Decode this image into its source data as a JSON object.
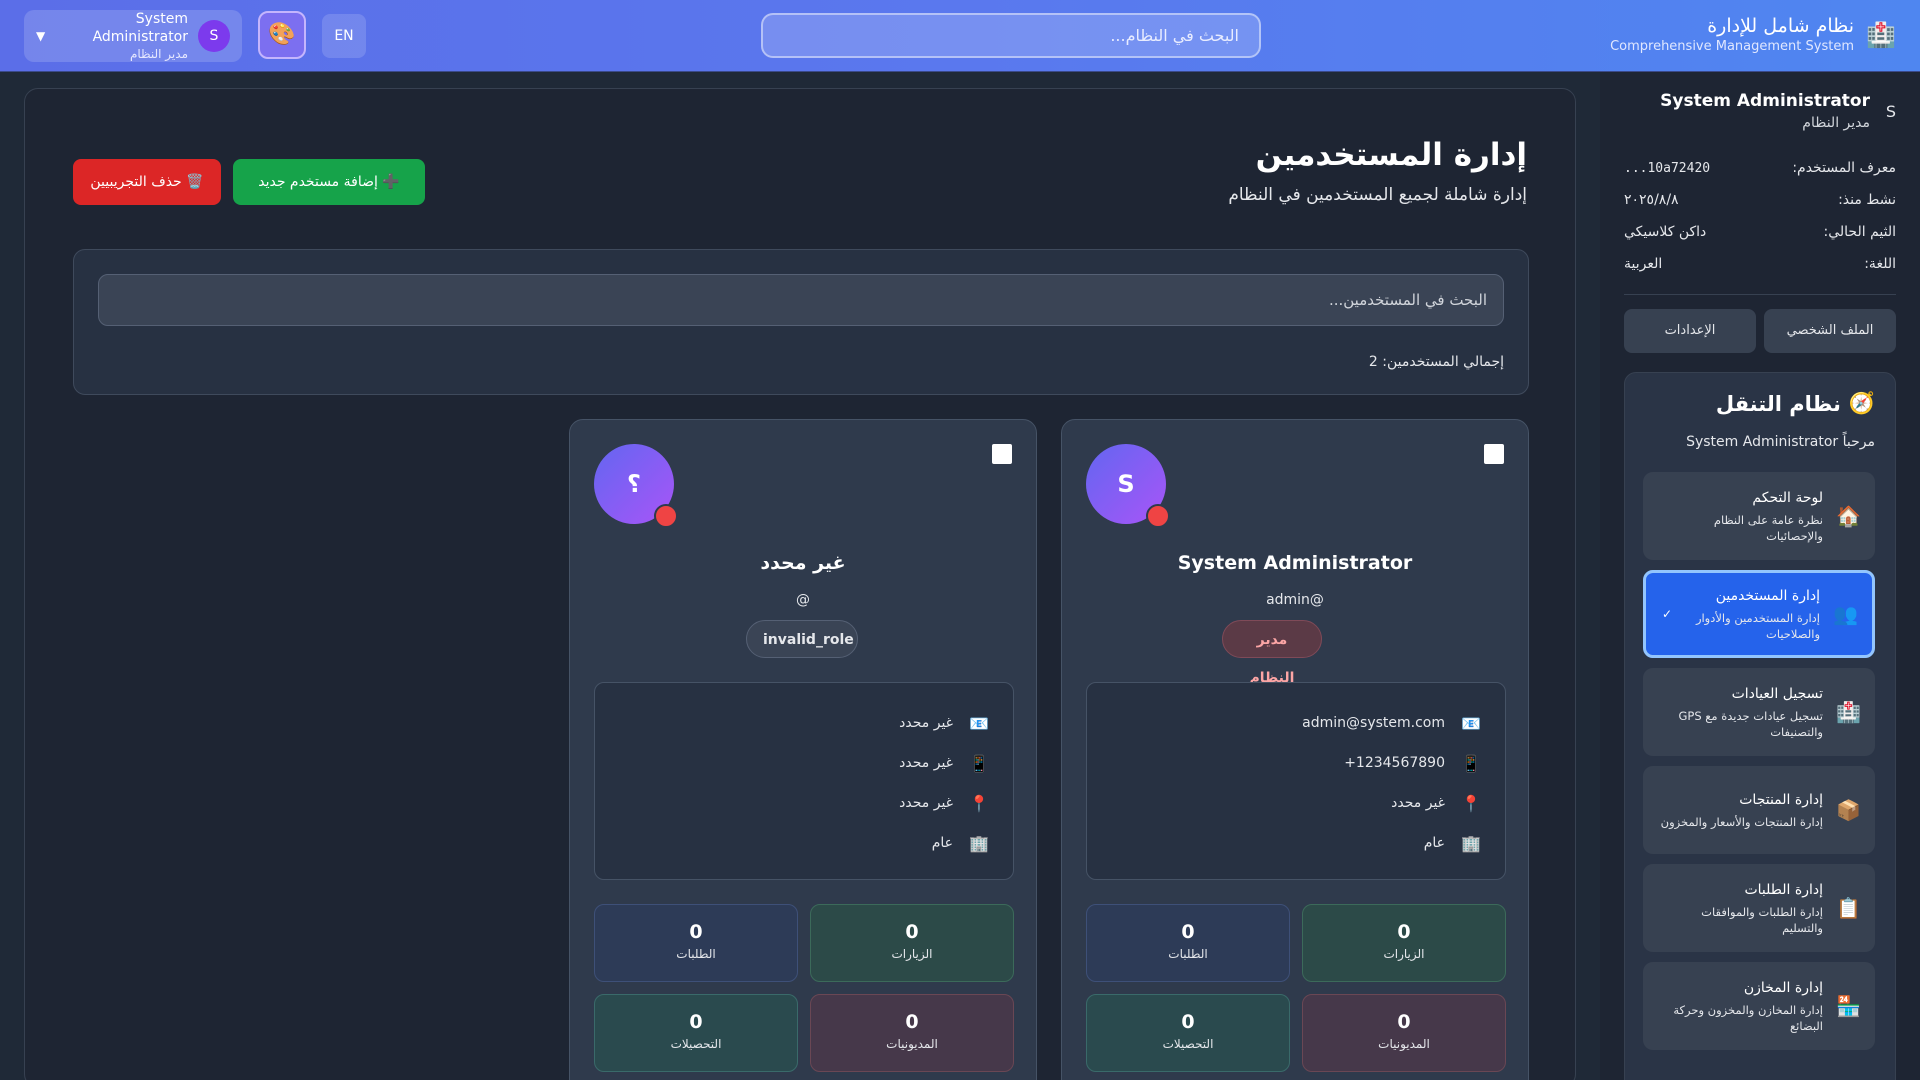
{
  "header": {
    "brand_title": "نظام شامل للإدارة",
    "brand_subtitle": "Comprehensive Management System",
    "brand_icon": "hospital-icon",
    "search_placeholder": "البحث في النظام...",
    "lang_label": "EN",
    "theme_icon": "palette-icon",
    "user_name": "System Administrator",
    "user_role": "مدير النظام",
    "user_initial": "S",
    "caret": "▼"
  },
  "sidebar": {
    "user_initial": "S",
    "user_name": "System Administrator",
    "user_role": "مدير النظام",
    "info": [
      {
        "label": "معرف المستخدم:",
        "value": "...10a72420"
      },
      {
        "label": "نشط منذ:",
        "value": "٢٠٢٥/٨/٨"
      },
      {
        "label": "الثيم الحالي:",
        "value": "داكن كلاسيكي"
      },
      {
        "label": "اللغة:",
        "value": "العربية"
      }
    ],
    "profile_button": "الملف الشخصي",
    "settings_button": "الإعدادات",
    "nav_title": "نظام التنقل",
    "nav_icon": "compass-icon",
    "welcome": "مرحباً System Administrator",
    "nav_items": [
      {
        "title": "لوحة التحكم",
        "desc": "نظرة عامة على النظام والإحصائيات",
        "icon": "home-icon",
        "glyph": "🏠",
        "active": false
      },
      {
        "title": "إدارة المستخدمين",
        "desc": "إدارة المستخدمين والأدوار والصلاحيات",
        "icon": "users-icon",
        "glyph": "👥",
        "active": true,
        "check": "✓"
      },
      {
        "title": "تسجيل العيادات",
        "desc": "تسجيل عيادات جديدة مع GPS والتصنيفات",
        "icon": "hospital-icon",
        "glyph": "🏥",
        "active": false
      },
      {
        "title": "إدارة المنتجات",
        "desc": "إدارة المنتجات والأسعار والمخزون",
        "icon": "package-icon",
        "glyph": "📦",
        "active": false
      },
      {
        "title": "إدارة الطلبات",
        "desc": "إدارة الطلبات والموافقات والتسليم",
        "icon": "clipboard-icon",
        "glyph": "📋",
        "active": false
      },
      {
        "title": "إدارة المخازن",
        "desc": "إدارة المخازن والمخزون وحركة البضائع",
        "icon": "store-icon",
        "glyph": "🏪",
        "active": false
      }
    ]
  },
  "main": {
    "title": "إدارة المستخدمين",
    "subtitle": "إدارة شاملة لجميع المستخدمين في النظام",
    "add_button": "إضافة مستخدم جديد",
    "add_icon": "plus-icon",
    "delete_button": "حذف التجريبيين",
    "delete_icon": "trash-icon",
    "search_placeholder": "البحث في المستخدمين...",
    "total_label": "إجمالي المستخدمين: 2"
  },
  "users": [
    {
      "initial": "S",
      "name": "System Administrator",
      "username": "admin@",
      "role": "مدير النظام",
      "role_color": "#fca5a5",
      "email": "admin@system.com",
      "phone": "+1234567890",
      "location": "غير محدد",
      "department": "عام",
      "stats": {
        "visits": "0",
        "visits_label": "الزيارات",
        "orders": "0",
        "orders_label": "الطلبات",
        "debts": "0",
        "debts_label": "المديونيات",
        "collections": "0",
        "collections_label": "التحصيلات"
      }
    },
    {
      "initial": "؟",
      "name": "غير محدد",
      "username": "@",
      "role": "invalid_role",
      "role_color": "#e5e7eb",
      "email": "غير محدد",
      "phone": "غير محدد",
      "location": "غير محدد",
      "department": "عام",
      "stats": {
        "visits": "0",
        "visits_label": "الزيارات",
        "orders": "0",
        "orders_label": "الطلبات",
        "debts": "0",
        "debts_label": "المديونيات",
        "collections": "0",
        "collections_label": "التحصيلات"
      }
    }
  ]
}
